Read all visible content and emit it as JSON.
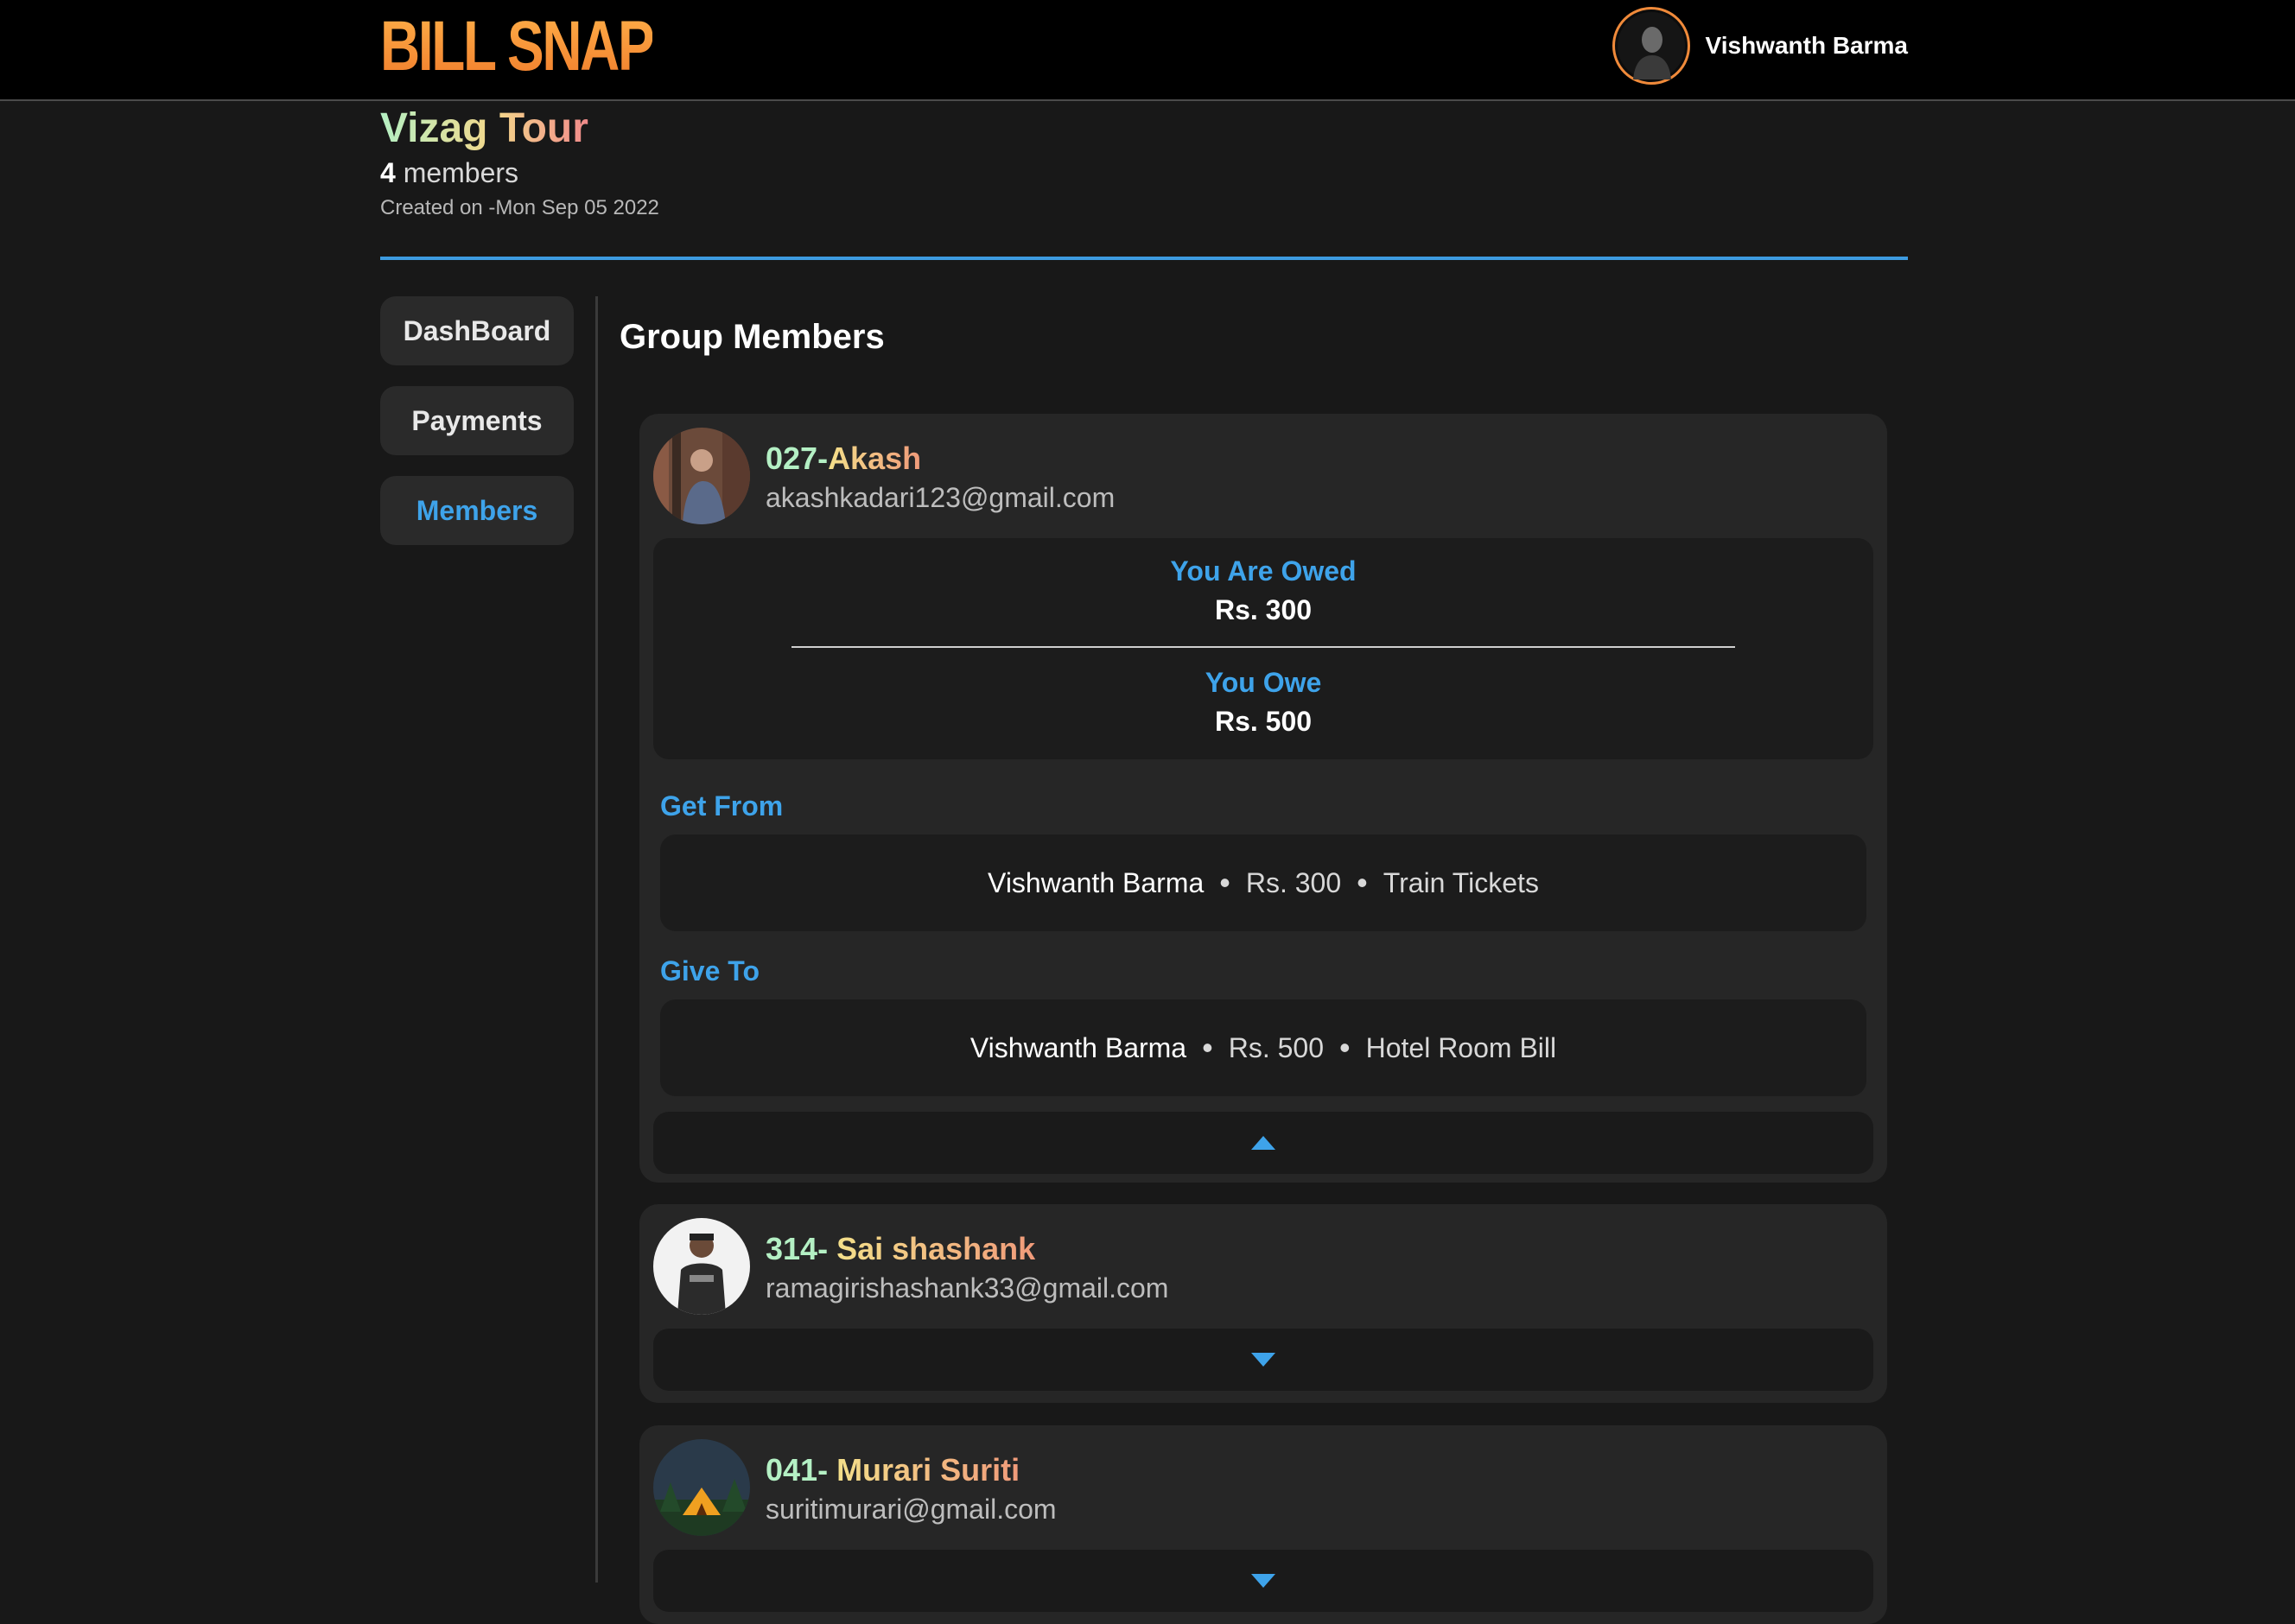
{
  "app": {
    "brand": "BILL SNAP"
  },
  "user": {
    "name": "Vishwanth Barma",
    "avatar_icon": "user-avatar"
  },
  "group": {
    "title": "Vizag Tour",
    "member_count": "4",
    "members_label": "members",
    "created": "Created on -Mon Sep 05 2022"
  },
  "nav": [
    {
      "label": "DashBoard",
      "active": false
    },
    {
      "label": "Payments",
      "active": false
    },
    {
      "label": "Members",
      "active": true
    }
  ],
  "section": {
    "title": "Group Members"
  },
  "members": [
    {
      "id": "027-",
      "name": "Akash",
      "email": "akashkadari123@gmail.com",
      "expanded": true,
      "owed_label": "You Are Owed",
      "owed_amount": "Rs. 300",
      "owe_label": "You Owe",
      "owe_amount": "Rs. 500",
      "get_from_label": "Get From",
      "get_from": {
        "person": "Vishwanth Barma",
        "amount": "Rs. 300",
        "note": "Train Tickets"
      },
      "give_to_label": "Give To",
      "give_to": {
        "person": "Vishwanth Barma",
        "amount": "Rs. 500",
        "note": "Hotel Room Bill"
      }
    },
    {
      "id": "314- ",
      "name": "Sai shashank",
      "email": "ramagirishashank33@gmail.com",
      "expanded": false
    },
    {
      "id": "041- ",
      "name": "Murari Suriti",
      "email": "suritimurari@gmail.com",
      "expanded": false
    }
  ],
  "colors": {
    "accent": "#3ea3ea",
    "brand": "#f08a3a",
    "background": "#181818",
    "card": "#262626"
  }
}
